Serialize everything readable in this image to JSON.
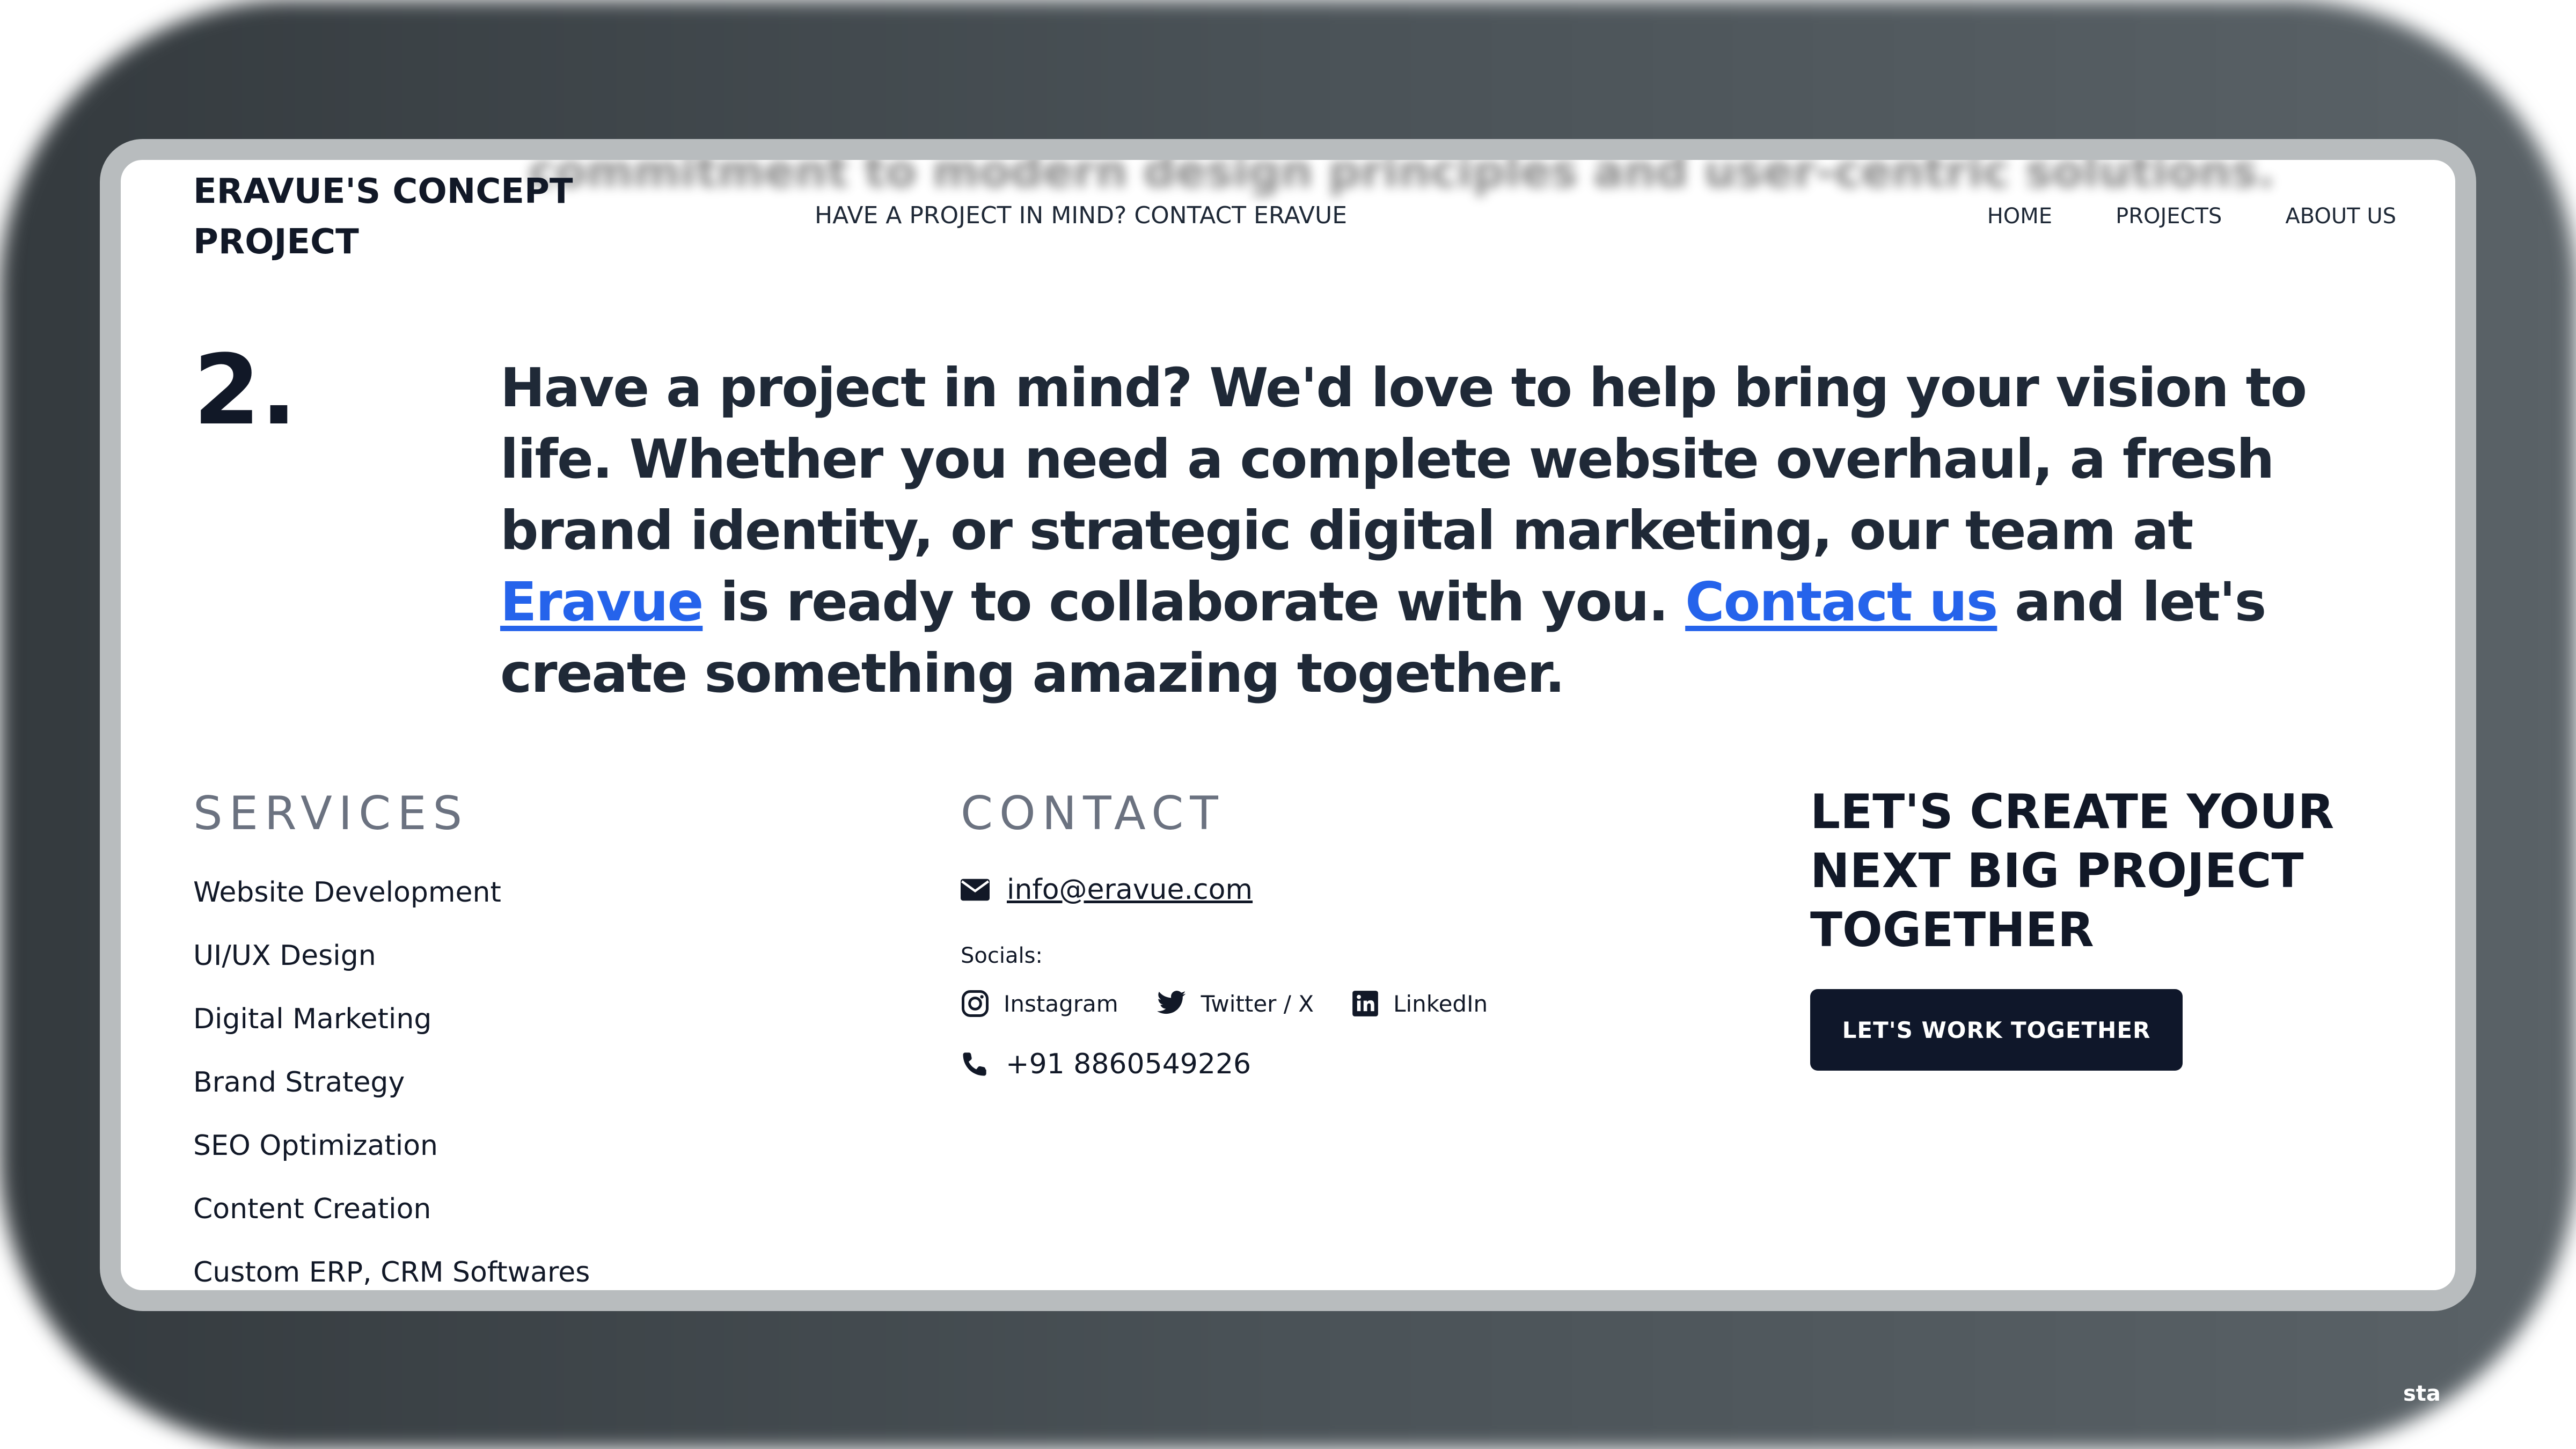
{
  "background_text": "commitment to modern design principles and user-centric solutions.",
  "header": {
    "brand": "ERAVUE'S CONCEPT PROJECT",
    "cta": "HAVE A PROJECT IN MIND? CONTACT ERAVUE",
    "nav": [
      "HOME",
      "PROJECTS",
      "ABOUT US"
    ]
  },
  "section": {
    "number": "2.",
    "text_1": "Have a project in mind? We'd love to help bring your vision to life. Whether you need a complete website overhaul, a fresh brand identity, or strategic digital marketing, our team at ",
    "link_1": "Eravue",
    "text_2": " is ready to collaborate with you. ",
    "link_2": "Contact us",
    "text_3": " and let's create something amazing together."
  },
  "services": {
    "title": "SERVICES",
    "items": [
      "Website Development",
      "UI/UX Design",
      "Digital Marketing",
      "Brand Strategy",
      "SEO Optimization",
      "Content Creation",
      "Custom ERP, CRM Softwares"
    ]
  },
  "contact": {
    "title": "CONTACT",
    "email": "info@eravue.com",
    "socials_label": "Socials:",
    "socials": [
      "Instagram",
      "Twitter / X",
      "LinkedIn"
    ],
    "phone": "+91 8860549226"
  },
  "cta_block": {
    "heading": "LET'S CREATE YOUR NEXT BIG PROJECT TOGETHER",
    "button": "LET'S WORK TOGETHER"
  },
  "watermark": "sta",
  "colors": {
    "link": "#2563eb",
    "button_bg": "#0f172a",
    "text": "#111827",
    "muted": "#6b7280"
  },
  "icons": {
    "email": "envelope-icon",
    "instagram": "instagram-icon",
    "twitter": "twitter-icon",
    "linkedin": "linkedin-icon",
    "phone": "phone-icon"
  }
}
